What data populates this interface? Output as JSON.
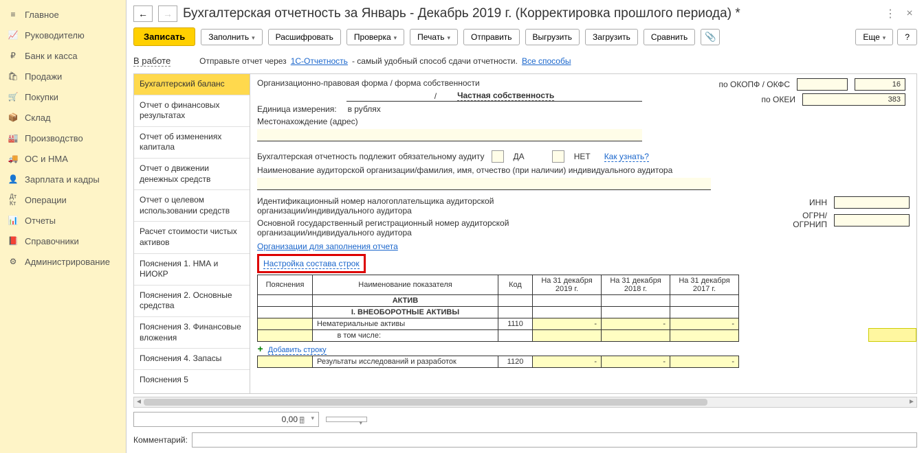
{
  "sidebar": {
    "items": [
      {
        "icon": "menu",
        "label": "Главное"
      },
      {
        "icon": "chart",
        "label": "Руководителю"
      },
      {
        "icon": "coin",
        "label": "Банк и касса"
      },
      {
        "icon": "bag",
        "label": "Продажи"
      },
      {
        "icon": "cart",
        "label": "Покупки"
      },
      {
        "icon": "box",
        "label": "Склад"
      },
      {
        "icon": "factory",
        "label": "Производство"
      },
      {
        "icon": "truck",
        "label": "ОС и НМА"
      },
      {
        "icon": "person",
        "label": "Зарплата и кадры"
      },
      {
        "icon": "dkkr",
        "label": "Операции"
      },
      {
        "icon": "bars",
        "label": "Отчеты"
      },
      {
        "icon": "book",
        "label": "Справочники"
      },
      {
        "icon": "gear",
        "label": "Администрирование"
      }
    ]
  },
  "header": {
    "title": "Бухгалтерская отчетность за Январь - Декабрь 2019 г. (Корректировка прошлого периода) *"
  },
  "toolbar": {
    "write": "Записать",
    "fill": "Заполнить",
    "decode": "Расшифровать",
    "check": "Проверка",
    "print": "Печать",
    "send": "Отправить",
    "export": "Выгрузить",
    "import": "Загрузить",
    "compare": "Сравнить",
    "more": "Еще",
    "help": "?"
  },
  "info": {
    "status": "В работе",
    "text1": "Отправьте отчет через",
    "link1": "1С-Отчетность",
    "text2": "- самый удобный способ сдачи отчетности.",
    "link2": "Все способы"
  },
  "tabs": {
    "items": [
      "Бухгалтерский баланс",
      "Отчет о финансовых результатах",
      "Отчет об изменениях капитала",
      "Отчет о движении денежных средств",
      "Отчет о целевом использовании средств",
      "Расчет стоимости чистых активов",
      "Пояснения 1. НМА и НИОКР",
      "Пояснения 2. Основные средства",
      "Пояснения 3. Финансовые вложения",
      "Пояснения 4. Запасы",
      "Пояснения 5"
    ]
  },
  "form": {
    "org_form_label": "Организационно-правовая форма / форма собственности",
    "own_form": "Частная собственность",
    "unit_label": "Единица измерения:",
    "unit_value": "в рублях",
    "address_label": "Местонахождение (адрес)",
    "okopf_label": "по ОКОПФ / ОКФС",
    "okopf_val": "16",
    "okei_label": "по ОКЕИ",
    "okei_val": "383",
    "audit_label": "Бухгалтерская отчетность подлежит обязательному аудиту",
    "yes": "ДА",
    "no": "НЕТ",
    "how_link": "Как узнать?",
    "auditor_name_label": "Наименование аудиторской организации/фамилия, имя, отчество (при наличии) индивидуального аудитора",
    "inn_label": "Идентификационный номер налогоплательщика аудиторской организации/индивидуального аудитора",
    "inn_short": "ИНН",
    "ogrn_label": "Основной государственный регистрационный номер аудиторской организации/индивидуального аудитора",
    "ogrn_short": "ОГРН/\nОГРНИП",
    "orgs_link": "Организации для заполнения отчета",
    "config_link": "Настройка состава строк"
  },
  "table": {
    "h_expl": "Пояснения",
    "h_name": "Наименование показателя",
    "h_code": "Код",
    "h_2019": "На 31 декабря 2019 г.",
    "h_2018": "На 31 декабря 2018 г.",
    "h_2017": "На 31 декабря 2017 г.",
    "aktiv": "АКТИВ",
    "section1": "I. ВНЕОБОРОТНЫЕ АКТИВЫ",
    "row1_name": "Нематериальные активы",
    "row1_code": "1110",
    "row1_sub": "в том числе:",
    "add_row": "Добавить строку",
    "row2_name": "Результаты исследований и разработок",
    "row2_code": "1120"
  },
  "bottom": {
    "num_value": "0,00",
    "comment_label": "Комментарий:"
  }
}
